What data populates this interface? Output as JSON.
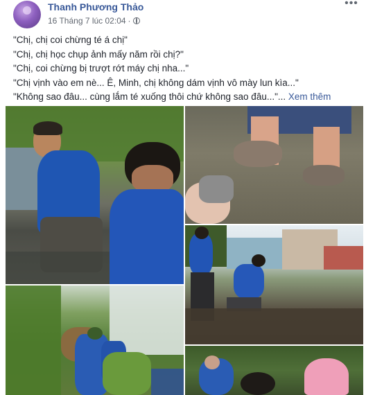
{
  "post": {
    "author": "Thanh Phương Thảo",
    "timestamp": "16 Tháng 7 lúc 02:04",
    "separator": "·",
    "more_icon": "more-options-icon",
    "lines": [
      "\"Chị, chị coi chừng té á chị\"",
      "\"Chị, chị học chụp ảnh mấy năm rồi chị?\"",
      "\"Chị, coi chừng bị trượt rớt máy chị nha...\"",
      "\"Chị vịnh vào em nè... Ê, Minh, chị không dám vịnh vô mày lun kìa...\"",
      "\"Không sao đâu... cùng lắm té xuống thôi chứ không sao đâu...\"..."
    ],
    "see_more": "Xem thêm",
    "photos": [
      {
        "name": "photo-1"
      },
      {
        "name": "photo-2"
      },
      {
        "name": "photo-3"
      },
      {
        "name": "photo-4"
      },
      {
        "name": "photo-5"
      }
    ]
  }
}
